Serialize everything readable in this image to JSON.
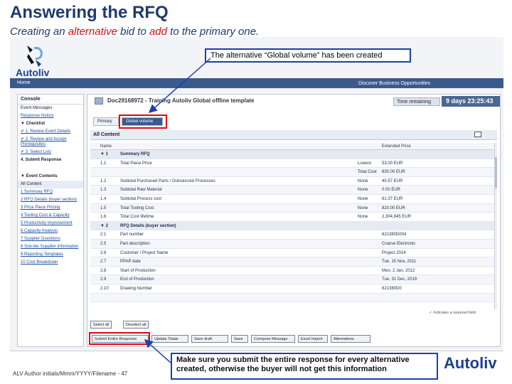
{
  "slide": {
    "title": "Answering the RFQ",
    "subtitle_pre": "Creating an ",
    "subtitle_alt": "alternative",
    "subtitle_mid": " bid to ",
    "subtitle_add": "add",
    "subtitle_post": " to the primary one."
  },
  "callouts": {
    "top": "The alternative “Global volume” has been created",
    "bottom": "Make sure you submit the entire response for every alternative created, otherwise the buyer will not get this information"
  },
  "footer": {
    "left": "ALV Author initials/Mmm/YYYY/Filename - 47",
    "brand": "Autoliv"
  },
  "app": {
    "logo_text": "Autoliv",
    "nav_home": "Home",
    "nav_link": "Discover Business Opportunities",
    "console_title": "Console",
    "doc_title": "Doc29168972 - Training Autoliv Global offline template",
    "time_label": "Time remaining",
    "time_value": "9 days 23:25:43",
    "tabs": {
      "primary": "Primary",
      "alternative": "Global volume"
    },
    "content_header": "All Content",
    "table_headers": {
      "name": "Name",
      "value": "Extended Price"
    },
    "console_items": [
      {
        "text": "Event Messages",
        "style": ""
      },
      {
        "text": "Response history",
        "style": "blue"
      },
      {
        "text": "▼ Checklist",
        "style": "bold"
      },
      {
        "text": "✔ 1. Review Event Details",
        "style": "blue"
      },
      {
        "text": "✔ 2. Review and Accept Prerequisites",
        "style": "blue"
      },
      {
        "text": "✔ 3. Select Lots",
        "style": "blue"
      },
      {
        "text": "4. Submit Response",
        "style": "bold"
      },
      {
        "text": "",
        "style": "gap"
      },
      {
        "text": "▼ Event Contents",
        "style": "bold"
      },
      {
        "text": "All Content",
        "style": "hl"
      },
      {
        "text": "1 Summary RFQ",
        "style": "blue"
      },
      {
        "text": "2 RFQ Details (buyer section)",
        "style": "blue"
      },
      {
        "text": "3 Price Piece Pricing",
        "style": "blue"
      },
      {
        "text": "4 Tooling Cost & Capacity",
        "style": "blue"
      },
      {
        "text": "5 Productivity Improvement",
        "style": "blue"
      },
      {
        "text": "6 Capacity Analysis",
        "style": "blue"
      },
      {
        "text": "7 Supplier Questions",
        "style": "blue"
      },
      {
        "text": "8 Sub-tier Supplier Information",
        "style": "blue"
      },
      {
        "text": "9 Reporting Templates",
        "style": "blue"
      },
      {
        "text": "10 Cost Breakdown",
        "style": "blue"
      }
    ],
    "rows": [
      {
        "num": "▼ 1",
        "name": "Summary RFQ",
        "mid": "",
        "val": "",
        "type": "group"
      },
      {
        "num": "1.1",
        "name": "Total Piece Price",
        "mid": "Lowest",
        "val": "53.00 EUR",
        "type": ""
      },
      {
        "num": "",
        "name": "",
        "mid": "Total Cost",
        "val": "830.00 EUR",
        "type": "zebra"
      },
      {
        "num": "1.2",
        "name": "Subtotal Purchased Parts / Outsourced Processes",
        "mid": "None",
        "val": "40.57 EUR",
        "type": ""
      },
      {
        "num": "1.3",
        "name": "Subtotal Raw Material",
        "mid": "None",
        "val": "0.00 EUR",
        "type": "zebra"
      },
      {
        "num": "1.4",
        "name": "Subtotal Process cost",
        "mid": "None",
        "val": "61.37 EUR",
        "type": ""
      },
      {
        "num": "1.5",
        "name": "Total Tooling Cost",
        "mid": "None",
        "val": "820.00 EUR",
        "type": "zebra"
      },
      {
        "num": "1.6",
        "name": "Total Cost lifetime",
        "mid": "None",
        "val": "2,304,945 EUR",
        "type": ""
      },
      {
        "num": "▼ 2",
        "name": "RFQ Details (buyer section)",
        "mid": "",
        "val": "",
        "type": "group"
      },
      {
        "num": "2.1",
        "name": "Part number",
        "mid": "",
        "val": "621380D004",
        "type": ""
      },
      {
        "num": "2.5",
        "name": "Part description",
        "mid": "",
        "val": "Coarse Electronic",
        "type": "zebra"
      },
      {
        "num": "2.6",
        "name": "Customer / Project Name",
        "mid": "",
        "val": "Project 2014",
        "type": ""
      },
      {
        "num": "2.7",
        "name": "PPAP date",
        "mid": "",
        "val": "Tue, 15 Nov, 2011",
        "type": "zebra"
      },
      {
        "num": "2.8",
        "name": "Start of Production",
        "mid": "",
        "val": "Mon, 2 Jan, 2012",
        "type": ""
      },
      {
        "num": "2.9",
        "name": "End of Production",
        "mid": "",
        "val": "Tue, 31 Dec, 2019",
        "type": "zebra"
      },
      {
        "num": "2.10",
        "name": "Drawing Number",
        "mid": "",
        "val": "621380D0",
        "type": ""
      },
      {
        "num": "",
        "name": "",
        "mid": "",
        "val": "",
        "type": "zebra"
      }
    ],
    "legend": "✓ Indicates a required field",
    "toolbar": [
      {
        "label": "Select all"
      },
      {
        "label": "Deselect all"
      }
    ],
    "actions": [
      {
        "label": "Submit Entire Response"
      },
      {
        "label": "Update Totals"
      },
      {
        "label": "Save draft"
      },
      {
        "label": "Save"
      },
      {
        "label": "Compose Message"
      },
      {
        "label": "Excel Import"
      },
      {
        "label": "Alternatives"
      }
    ]
  }
}
